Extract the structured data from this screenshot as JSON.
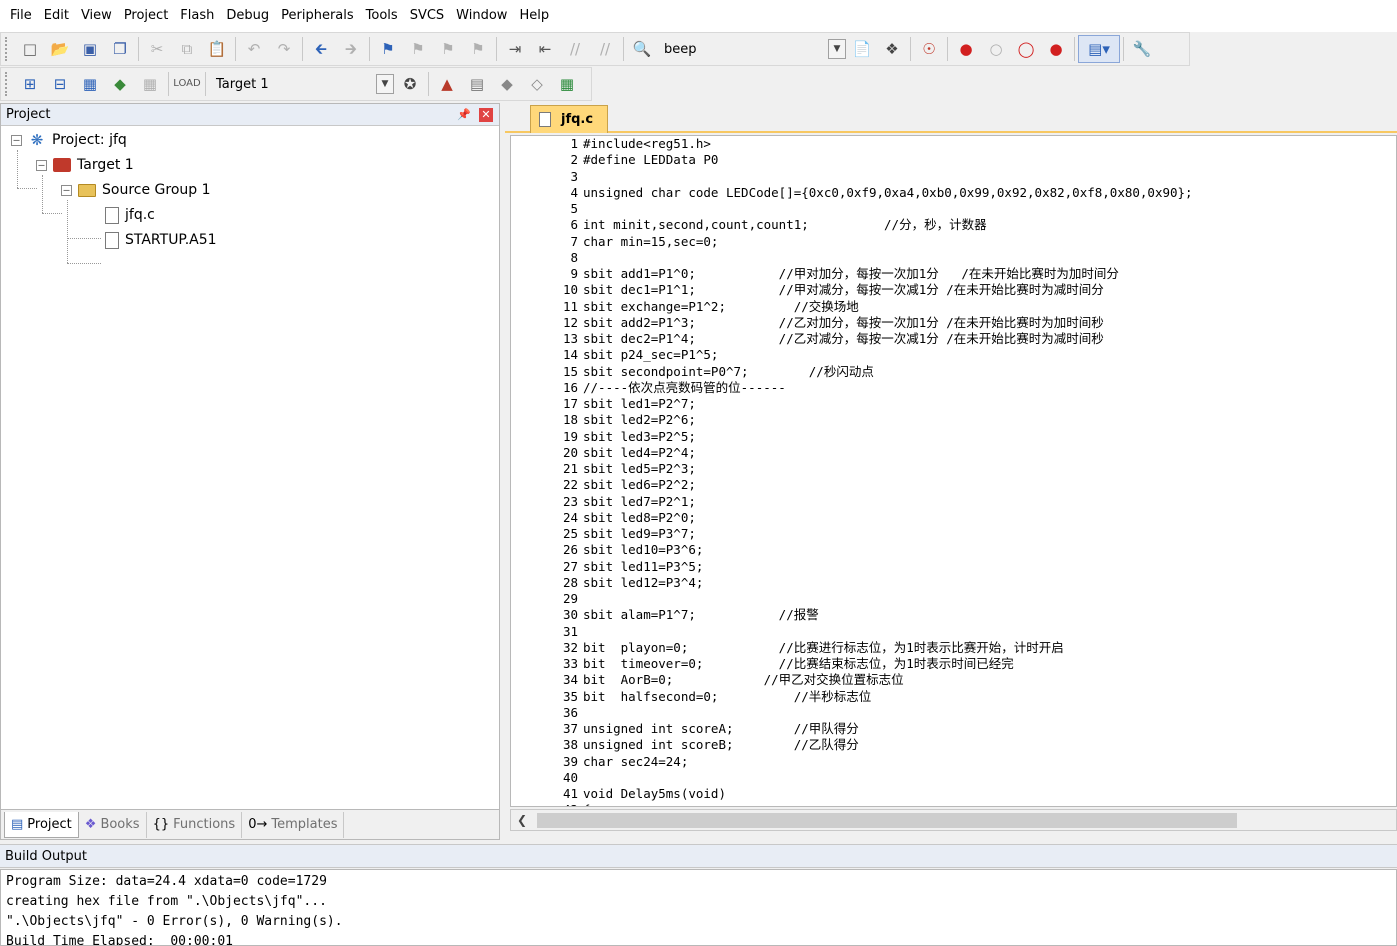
{
  "menu": [
    "File",
    "Edit",
    "View",
    "Project",
    "Flash",
    "Debug",
    "Peripherals",
    "Tools",
    "SVCS",
    "Window",
    "Help"
  ],
  "toolbar": {
    "find_value": "beep",
    "target_value": "Target 1"
  },
  "project_panel": {
    "title": "Project",
    "tree": {
      "project": "Project: jfq",
      "target": "Target 1",
      "group": "Source Group 1",
      "files": [
        "jfq.c",
        "STARTUP.A51"
      ]
    },
    "tabs": [
      "Project",
      "Books",
      "Functions",
      "Templates"
    ]
  },
  "editor": {
    "tab_title": "jfq.c",
    "lines": [
      "#include<reg51.h>",
      "#define LEDData P0",
      "",
      "unsigned char code LEDCode[]={0xc0,0xf9,0xa4,0xb0,0x99,0x92,0x82,0xf8,0x80,0x90};",
      "",
      "int minit,second,count,count1;          //分，秒，计数器",
      "char min=15,sec=0;",
      "",
      "sbit add1=P1^0;           //甲对加分，每按一次加1分   /在未开始比赛时为加时间分",
      "sbit dec1=P1^1;           //甲对减分，每按一次减1分 /在未开始比赛时为减时间分",
      "sbit exchange=P1^2;         //交换场地",
      "sbit add2=P1^3;           //乙对加分，每按一次加1分 /在未开始比赛时为加时间秒",
      "sbit dec2=P1^4;           //乙对减分，每按一次减1分 /在未开始比赛时为减时间秒",
      "sbit p24_sec=P1^5;",
      "sbit secondpoint=P0^7;        //秒闪动点",
      "//----依次点亮数码管的位------",
      "sbit led1=P2^7;",
      "sbit led2=P2^6;",
      "sbit led3=P2^5;",
      "sbit led4=P2^4;",
      "sbit led5=P2^3;",
      "sbit led6=P2^2;",
      "sbit led7=P2^1;",
      "sbit led8=P2^0;",
      "sbit led9=P3^7;",
      "sbit led10=P3^6;",
      "sbit led11=P3^5;",
      "sbit led12=P3^4;",
      "",
      "sbit alam=P1^7;           //报警",
      "",
      "bit  playon=0;            //比赛进行标志位，为1时表示比赛开始，计时开启",
      "bit  timeover=0;          //比赛结束标志位，为1时表示时间已经完",
      "bit  AorB=0;            //甲乙对交换位置标志位",
      "bit  halfsecond=0;          //半秒标志位",
      "",
      "unsigned int scoreA;        //甲队得分",
      "unsigned int scoreB;        //乙队得分",
      "char sec24=24;",
      "",
      "void Delay5ms(void)",
      "{"
    ]
  },
  "build_output": {
    "title": "Build Output",
    "lines": [
      "Program Size: data=24.4 xdata=0 code=1729",
      "creating hex file from \".\\Objects\\jfq\"...",
      "\".\\Objects\\jfq\" - 0 Error(s), 0 Warning(s).",
      "Build Time Elapsed:  00:00:01"
    ]
  }
}
